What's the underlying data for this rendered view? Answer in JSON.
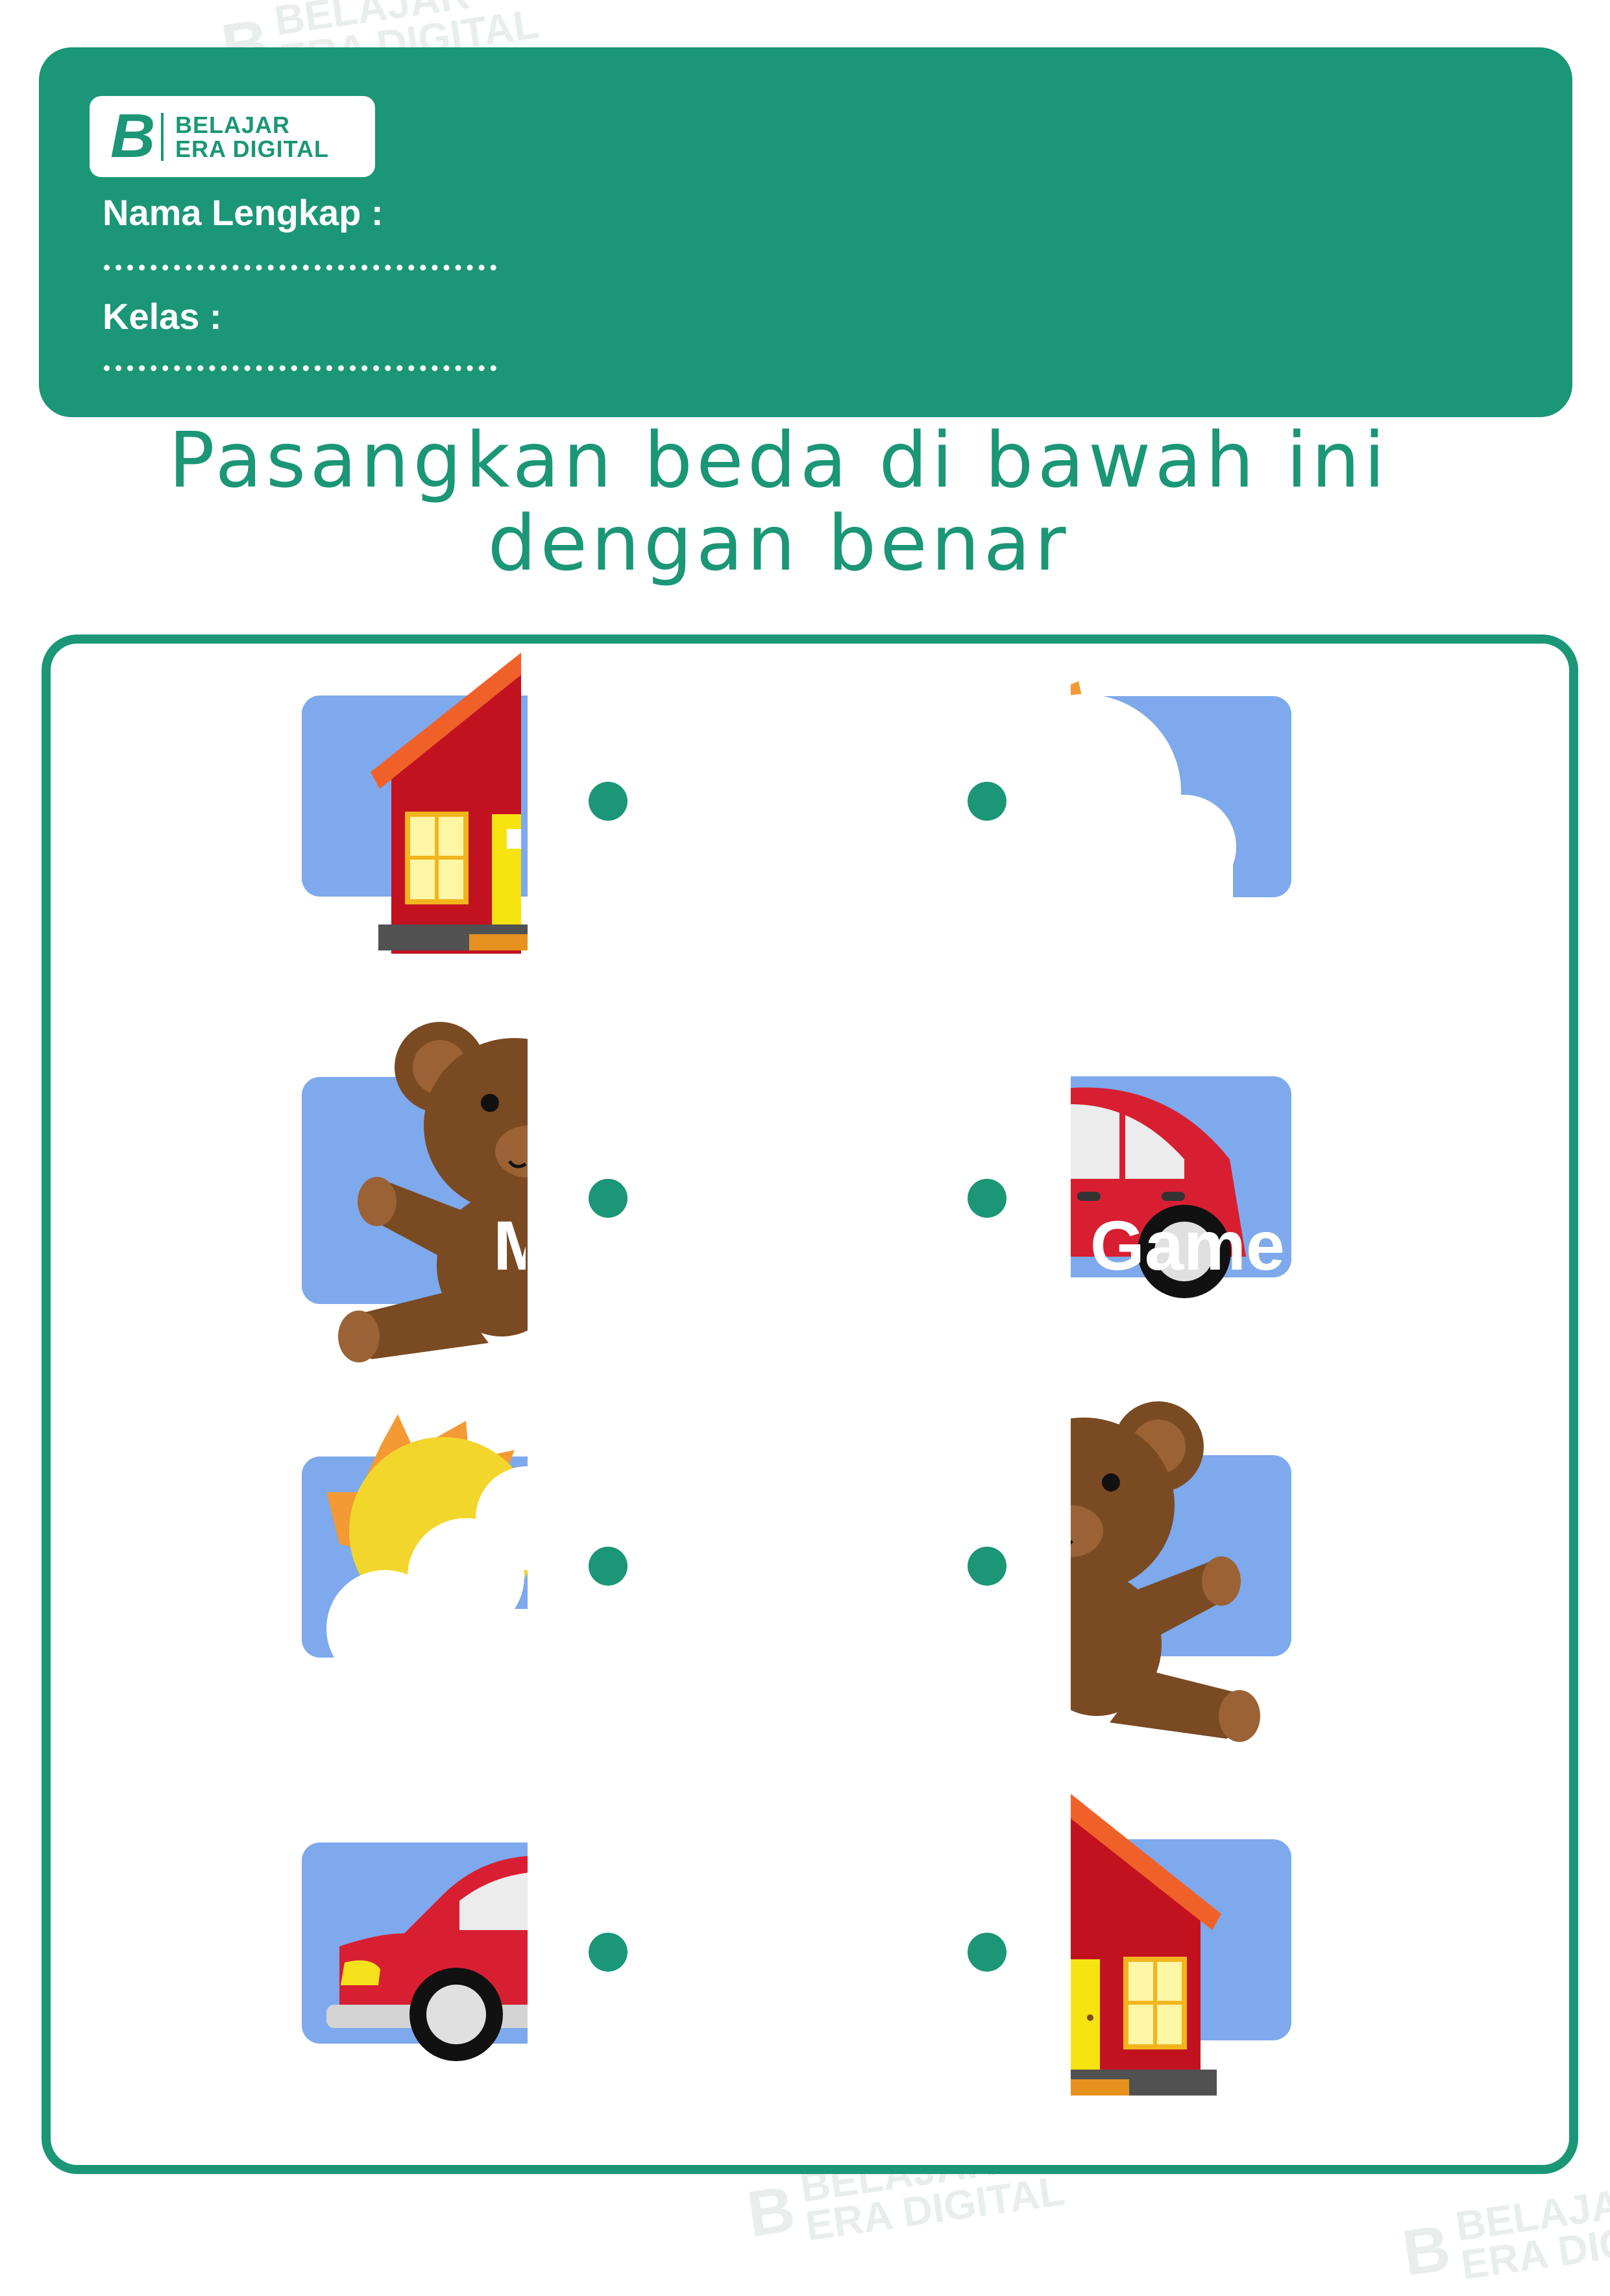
{
  "brand": {
    "line1": "BELAJAR",
    "line2": "ERA DIGITAL"
  },
  "form": {
    "name_label": "Nama Lengkap :",
    "class_label": "Kelas :"
  },
  "title": {
    "line1": "Pasangkan beda di bawah ini",
    "line2": "dengan benar"
  },
  "overlay_text": {
    "left_fragment": "M",
    "right_fragment": "s Game"
  },
  "left_column": [
    {
      "picture": "house-left-half-icon"
    },
    {
      "picture": "teddy-bear-left-half-icon"
    },
    {
      "picture": "sun-cloud-left-half-icon"
    },
    {
      "picture": "car-left-half-icon"
    }
  ],
  "right_column": [
    {
      "picture": "sun-cloud-right-half-icon"
    },
    {
      "picture": "car-right-half-icon"
    },
    {
      "picture": "teddy-bear-right-half-icon"
    },
    {
      "picture": "house-right-half-icon"
    }
  ],
  "colors": {
    "primary": "#1b9677",
    "sky": "#7ea9ec",
    "house_red": "#c21220",
    "roof_orange": "#f0612a",
    "bear_brown": "#7a4a23",
    "car_red": "#d81f32",
    "sun_yellow": "#f2d62b"
  }
}
